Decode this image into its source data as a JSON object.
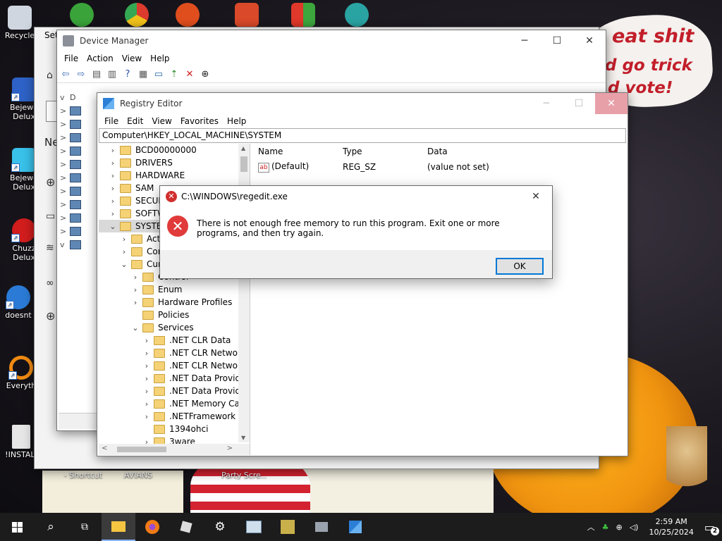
{
  "desktop": {
    "wallpaper_text": [
      "eat shit",
      "d go trick",
      "d vote!"
    ],
    "icons": [
      {
        "label": "Recycle",
        "icon": "recycle-bin-icon",
        "color": "#cfd6e0"
      },
      {
        "label": "Bejewel Delux",
        "icon": "bejeweled-icon",
        "color": "#2e62c7"
      },
      {
        "label": "Bejewe Delux",
        "icon": "gem-icon",
        "color": "#39c1ea"
      },
      {
        "label": "Chuzz Delux",
        "icon": "chuzzle-icon",
        "color": "#d21d1d"
      },
      {
        "label": "doesnt",
        "icon": "bird-icon",
        "color": "#2b7bd6"
      },
      {
        "label": "Everyth",
        "icon": "search-app-icon",
        "color": "#f08a12"
      },
      {
        "label": "!INSTALI",
        "icon": "document-icon",
        "color": "#e6e6e6"
      }
    ],
    "top_icons": [
      {
        "icon": "users-icon",
        "color": "#3aa43a"
      },
      {
        "icon": "chrome-icon",
        "color": "#dc3b2e"
      },
      {
        "icon": "app-icon",
        "color": "#e04e1e"
      },
      {
        "icon": "app-icon",
        "color": "#d9492a"
      },
      {
        "icon": "windows-icon",
        "color": "#e0382a"
      },
      {
        "icon": "character-icon",
        "color": "#2aa3a3"
      }
    ],
    "bottom_labels": [
      "- Shortcut",
      "AVIANS",
      "Party Scre..."
    ]
  },
  "settings_window": {
    "title": "Set",
    "side_letters": [
      "Ne"
    ]
  },
  "device_manager": {
    "title": "Device Manager",
    "menu": [
      "File",
      "Action",
      "View",
      "Help"
    ],
    "tree_root": "D"
  },
  "registry_editor": {
    "title": "Registry Editor",
    "menu": [
      "File",
      "Edit",
      "View",
      "Favorites",
      "Help"
    ],
    "address": "Computer\\HKEY_LOCAL_MACHINE\\SYSTEM",
    "tree": [
      {
        "label": "BCD00000000",
        "level": 0,
        "expander": ">"
      },
      {
        "label": "DRIVERS",
        "level": 0,
        "expander": ">"
      },
      {
        "label": "HARDWARE",
        "level": 0,
        "expander": ">"
      },
      {
        "label": "SAM",
        "level": 0,
        "expander": ">"
      },
      {
        "label": "SECUR",
        "level": 0,
        "expander": ">"
      },
      {
        "label": "SOFTW",
        "level": 0,
        "expander": ">"
      },
      {
        "label": "SYSTEM",
        "level": 0,
        "expander": "v",
        "selected": true
      },
      {
        "label": "Acti",
        "level": 1,
        "expander": ">"
      },
      {
        "label": "Cor",
        "level": 1,
        "expander": ">"
      },
      {
        "label": "Cur",
        "level": 1,
        "expander": "v"
      },
      {
        "label": "Control",
        "level": 2,
        "expander": ">"
      },
      {
        "label": "Enum",
        "level": 2,
        "expander": ">"
      },
      {
        "label": "Hardware Profiles",
        "level": 2,
        "expander": ">"
      },
      {
        "label": "Policies",
        "level": 2,
        "expander": ""
      },
      {
        "label": "Services",
        "level": 2,
        "expander": "v"
      },
      {
        "label": ".NET CLR Data",
        "level": 3,
        "expander": ">"
      },
      {
        "label": ".NET CLR Network",
        "level": 3,
        "expander": ">"
      },
      {
        "label": ".NET CLR Network",
        "level": 3,
        "expander": ">"
      },
      {
        "label": ".NET Data Provider",
        "level": 3,
        "expander": ">"
      },
      {
        "label": ".NET Data Provider",
        "level": 3,
        "expander": ">"
      },
      {
        "label": ".NET Memory Cac",
        "level": 3,
        "expander": ">"
      },
      {
        "label": ".NETFramework",
        "level": 3,
        "expander": ">"
      },
      {
        "label": "1394ohci",
        "level": 3,
        "expander": ""
      },
      {
        "label": "3ware",
        "level": 3,
        "expander": ">"
      }
    ],
    "columns": [
      "Name",
      "Type",
      "Data"
    ],
    "rows": [
      {
        "name": "(Default)",
        "type": "REG_SZ",
        "data": "(value not set)"
      }
    ]
  },
  "error_dialog": {
    "title": "C:\\WINDOWS\\regedit.exe",
    "message": "There is not enough free memory to run this program. Exit one or more programs, and then try again.",
    "ok_label": "OK"
  },
  "taskbar": {
    "time": "2:59 AM",
    "date": "10/25/2024",
    "notification_count": "2"
  }
}
